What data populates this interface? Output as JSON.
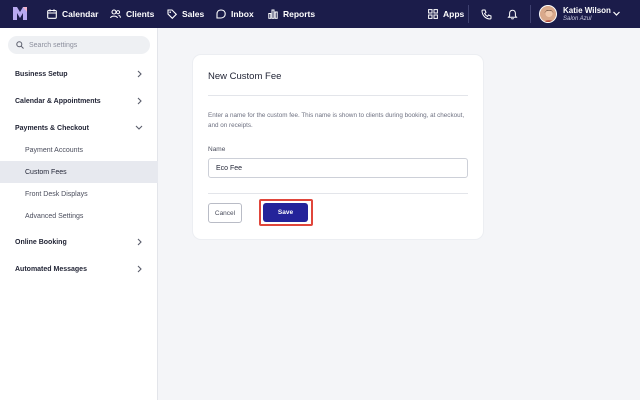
{
  "nav": {
    "items": [
      {
        "label": "Calendar",
        "icon": "calendar-icon"
      },
      {
        "label": "Clients",
        "icon": "clients-icon"
      },
      {
        "label": "Sales",
        "icon": "tag-icon"
      },
      {
        "label": "Inbox",
        "icon": "inbox-icon"
      },
      {
        "label": "Reports",
        "icon": "bar-chart-icon"
      }
    ],
    "apps_label": "Apps",
    "user": {
      "name": "Katie Wilson",
      "subtitle": "Salon Azul"
    },
    "colors": {
      "bar": "#1b1c4a",
      "logo": "#b8a9f0"
    }
  },
  "sidebar": {
    "search_placeholder": "Search settings",
    "sections": [
      {
        "label": "Business Setup",
        "expanded": false
      },
      {
        "label": "Calendar & Appointments",
        "expanded": false
      },
      {
        "label": "Payments & Checkout",
        "expanded": true,
        "items": [
          "Payment Accounts",
          "Custom Fees",
          "Front Desk Displays",
          "Advanced Settings"
        ],
        "active_item": "Custom Fees"
      },
      {
        "label": "Online Booking",
        "expanded": false
      },
      {
        "label": "Automated Messages",
        "expanded": false
      }
    ]
  },
  "form": {
    "title": "New Custom Fee",
    "description": "Enter a name for the custom fee. This name is shown to clients during booking, at checkout, and on receipts.",
    "name_label": "Name",
    "name_value": "Eco Fee",
    "cancel_label": "Cancel",
    "save_label": "Save",
    "colors": {
      "primary": "#24239a",
      "highlight": "#e0463b"
    }
  }
}
